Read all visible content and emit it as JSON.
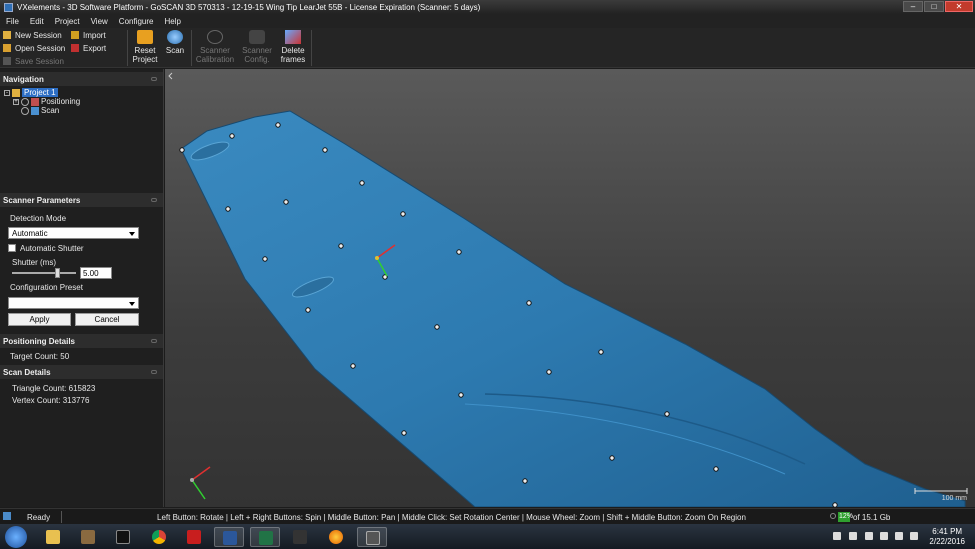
{
  "window": {
    "title": "VXelements - 3D Software Platform - GoSCAN 3D 570313 - 12-19-15 Wing Tip LearJet 55B - License Expiration (Scanner: 5 days)",
    "minimize": "–",
    "maximize": "□",
    "close": "✕"
  },
  "menu": [
    "File",
    "Edit",
    "Project",
    "View",
    "Configure",
    "Help"
  ],
  "toolbar": {
    "new_session": "New Session",
    "open_session": "Open Session",
    "save_session": "Save Session",
    "import": "Import",
    "export": "Export",
    "reset_project": [
      "Reset",
      "Project"
    ],
    "scan": "Scan",
    "scanner_calibration": [
      "Scanner",
      "Calibration"
    ],
    "scanner_config": [
      "Scanner",
      "Config."
    ],
    "delete_frames": [
      "Delete",
      "frames"
    ]
  },
  "navigation": {
    "header": "Navigation",
    "project": "Project 1",
    "positioning": "Positioning",
    "scan": "Scan"
  },
  "scanner_parameters": {
    "header": "Scanner Parameters",
    "detection_mode_label": "Detection Mode",
    "detection_mode_value": "Automatic",
    "automatic_shutter": "Automatic Shutter",
    "shutter_label": "Shutter (ms)",
    "shutter_value": "5.00",
    "configuration_preset_label": "Configuration Preset",
    "configuration_preset_value": "",
    "apply": "Apply",
    "cancel": "Cancel"
  },
  "positioning_details": {
    "header": "Positioning Details",
    "target_count": "Target Count: 50"
  },
  "scan_details": {
    "header": "Scan Details",
    "triangle_count": "Triangle Count: 615823",
    "vertex_count": "Vertex Count: 313776"
  },
  "viewport": {
    "scale_label": "100 mm"
  },
  "status": {
    "ready": "Ready",
    "hints": "Left Button: Rotate  |  Left + Right Buttons: Spin  |  Middle Button: Pan  |  Middle Click: Set Rotation Center  |  Mouse Wheel: Zoom  |  Shift + Middle Button: Zoom On Region",
    "memory_pct": "12%",
    "memory_text": "of 15.1 Gb"
  },
  "taskbar": {
    "time": "6:41 PM",
    "date": "2/22/2016"
  },
  "colors": {
    "wing": "#2d7ab0",
    "wing_dark": "#1f5f8f",
    "selection": "#2d6ec4"
  }
}
